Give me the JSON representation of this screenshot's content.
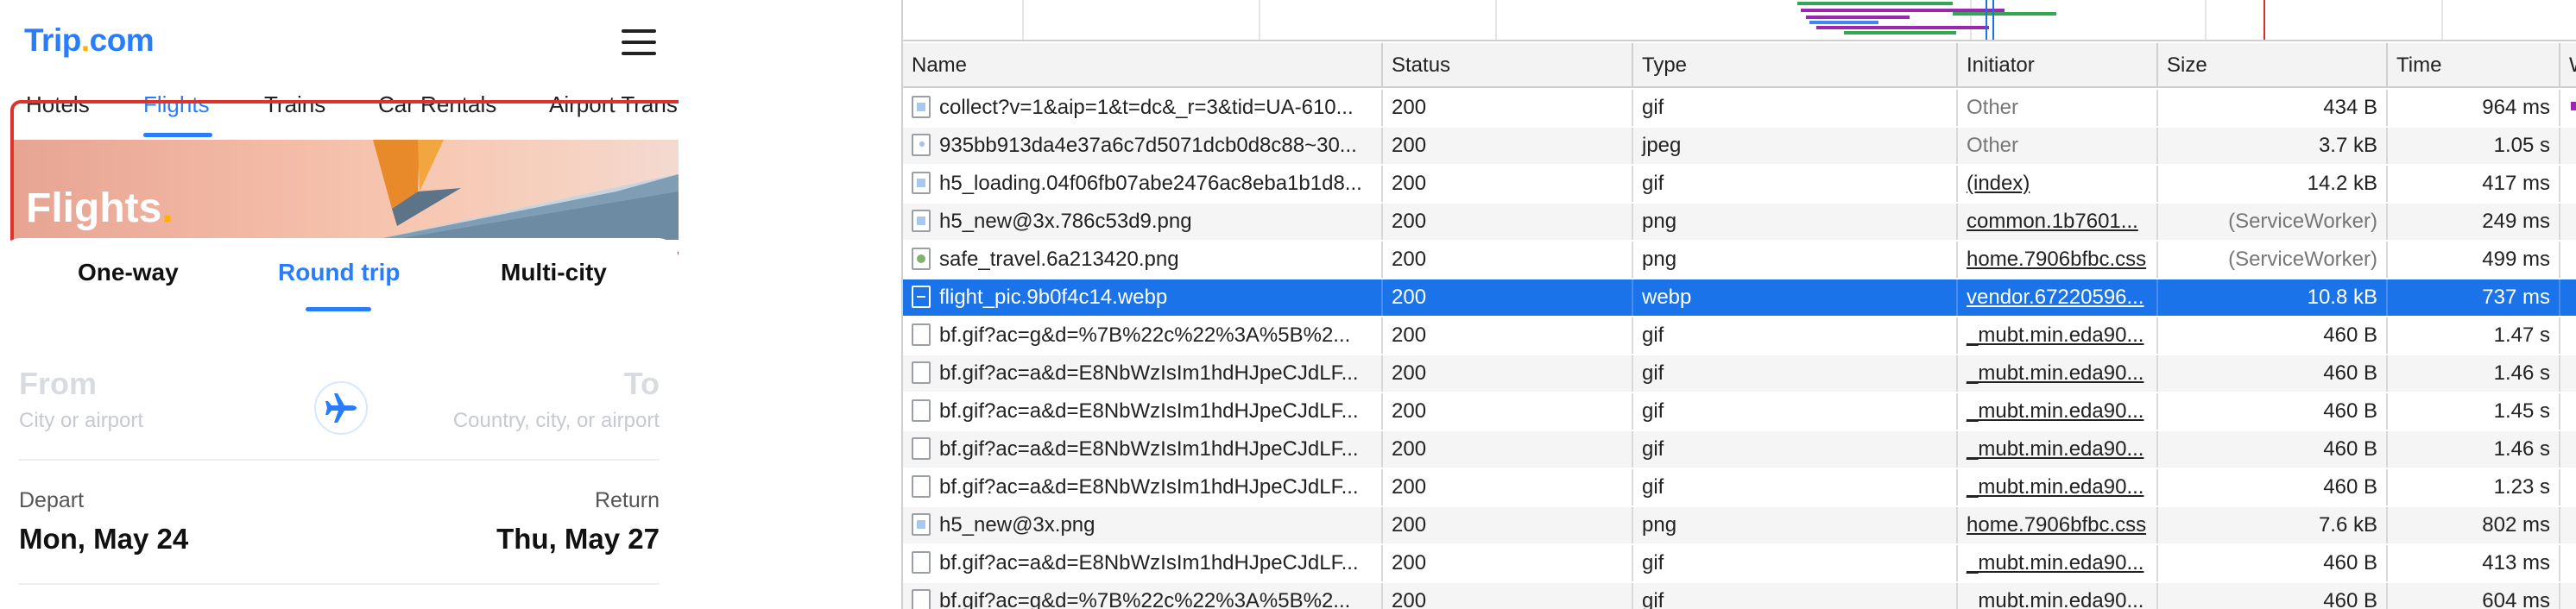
{
  "mobile": {
    "logo": {
      "text": "Trip",
      "dot": ".",
      "suffix": "com"
    },
    "nav_tabs": [
      "Hotels",
      "Flights",
      "Trains",
      "Car Rentals",
      "Airport Trans"
    ],
    "active_tab": "Flights",
    "hero": {
      "title": "Flights",
      "dot": "."
    },
    "trip_types": [
      "One-way",
      "Round trip",
      "Multi-city"
    ],
    "active_trip_type": "Round trip",
    "from": {
      "label": "From",
      "placeholder": "City or airport"
    },
    "to": {
      "label": "To",
      "placeholder": "Country, city, or airport"
    },
    "depart": {
      "label": "Depart",
      "value": "Mon, May 24"
    },
    "return": {
      "label": "Return",
      "value": "Thu, May 27"
    },
    "colors": {
      "brand": "#287dfa",
      "accent": "#ffb000",
      "highlight": "#e0322b"
    }
  },
  "devtools": {
    "columns": [
      "Name",
      "Status",
      "Type",
      "Initiator",
      "Size",
      "Time",
      "W"
    ],
    "rows": [
      {
        "icon": "image-file-icon",
        "name": "collect?v=1&aip=1&t=dc&_r=3&tid=UA-610...",
        "status": "200",
        "type": "gif",
        "initiator": "Other",
        "initiator_style": "gray",
        "size": "434 B",
        "size_style": "",
        "time": "964 ms"
      },
      {
        "icon": "document-file-icon",
        "name": "935bb913da4e37a6c7d5071dcb0d8c88~30...",
        "status": "200",
        "type": "jpeg",
        "initiator": "Other",
        "initiator_style": "gray",
        "size": "3.7 kB",
        "size_style": "",
        "time": "1.05 s"
      },
      {
        "icon": "image-file-icon",
        "name": "h5_loading.04f06fb07abe2476ac8eba1b1d8...",
        "status": "200",
        "type": "gif",
        "initiator": "(index)",
        "initiator_style": "link",
        "size": "14.2 kB",
        "size_style": "",
        "time": "417 ms"
      },
      {
        "icon": "image-file-icon",
        "name": "h5_new@3x.786c53d9.png",
        "status": "200",
        "type": "png",
        "initiator": "common.1b7601...",
        "initiator_style": "link",
        "size": "(ServiceWorker)",
        "size_style": "gray",
        "time": "249 ms"
      },
      {
        "icon": "image-green-icon",
        "name": "safe_travel.6a213420.png",
        "status": "200",
        "type": "png",
        "initiator": "home.7906bfbc.css",
        "initiator_style": "link",
        "size": "(ServiceWorker)",
        "size_style": "gray",
        "time": "499 ms"
      },
      {
        "icon": "selected-file-icon",
        "name": "flight_pic.9b0f4c14.webp",
        "status": "200",
        "type": "webp",
        "initiator": "vendor.67220596...",
        "initiator_style": "link",
        "size": "10.8 kB",
        "size_style": "",
        "time": "737 ms",
        "selected": true
      },
      {
        "icon": "blank-file-icon",
        "name": "bf.gif?ac=g&d=%7B%22c%22%3A%5B%2...",
        "status": "200",
        "type": "gif",
        "initiator": "_mubt.min.eda90...",
        "initiator_style": "link",
        "size": "460 B",
        "size_style": "",
        "time": "1.47 s"
      },
      {
        "icon": "blank-file-icon",
        "name": "bf.gif?ac=a&d=E8NbWzIsIm1hdHJpeCJdLF...",
        "status": "200",
        "type": "gif",
        "initiator": "_mubt.min.eda90...",
        "initiator_style": "link",
        "size": "460 B",
        "size_style": "",
        "time": "1.46 s"
      },
      {
        "icon": "blank-file-icon",
        "name": "bf.gif?ac=a&d=E8NbWzIsIm1hdHJpeCJdLF...",
        "status": "200",
        "type": "gif",
        "initiator": "_mubt.min.eda90...",
        "initiator_style": "link",
        "size": "460 B",
        "size_style": "",
        "time": "1.45 s"
      },
      {
        "icon": "blank-file-icon",
        "name": "bf.gif?ac=a&d=E8NbWzIsIm1hdHJpeCJdLF...",
        "status": "200",
        "type": "gif",
        "initiator": "_mubt.min.eda90...",
        "initiator_style": "link",
        "size": "460 B",
        "size_style": "",
        "time": "1.46 s"
      },
      {
        "icon": "blank-file-icon",
        "name": "bf.gif?ac=a&d=E8NbWzIsIm1hdHJpeCJdLF...",
        "status": "200",
        "type": "gif",
        "initiator": "_mubt.min.eda90...",
        "initiator_style": "link",
        "size": "460 B",
        "size_style": "",
        "time": "1.23 s"
      },
      {
        "icon": "image-file-icon",
        "name": "h5_new@3x.png",
        "status": "200",
        "type": "png",
        "initiator": "home.7906bfbc.css",
        "initiator_style": "link",
        "size": "7.6 kB",
        "size_style": "",
        "time": "802 ms"
      },
      {
        "icon": "blank-file-icon",
        "name": "bf.gif?ac=a&d=E8NbWzIsIm1hdHJpeCJdLF...",
        "status": "200",
        "type": "gif",
        "initiator": "_mubt.min.eda90...",
        "initiator_style": "link",
        "size": "460 B",
        "size_style": "",
        "time": "413 ms"
      },
      {
        "icon": "blank-file-icon",
        "name": "bf.gif?ac=g&d=%7B%22c%22%3A%5B%2...",
        "status": "200",
        "type": "gif",
        "initiator": "_mubt.min.eda90...",
        "initiator_style": "link",
        "size": "460 B",
        "size_style": "",
        "time": "604 ms"
      }
    ],
    "colors": {
      "selection": "#1a73e8"
    }
  }
}
